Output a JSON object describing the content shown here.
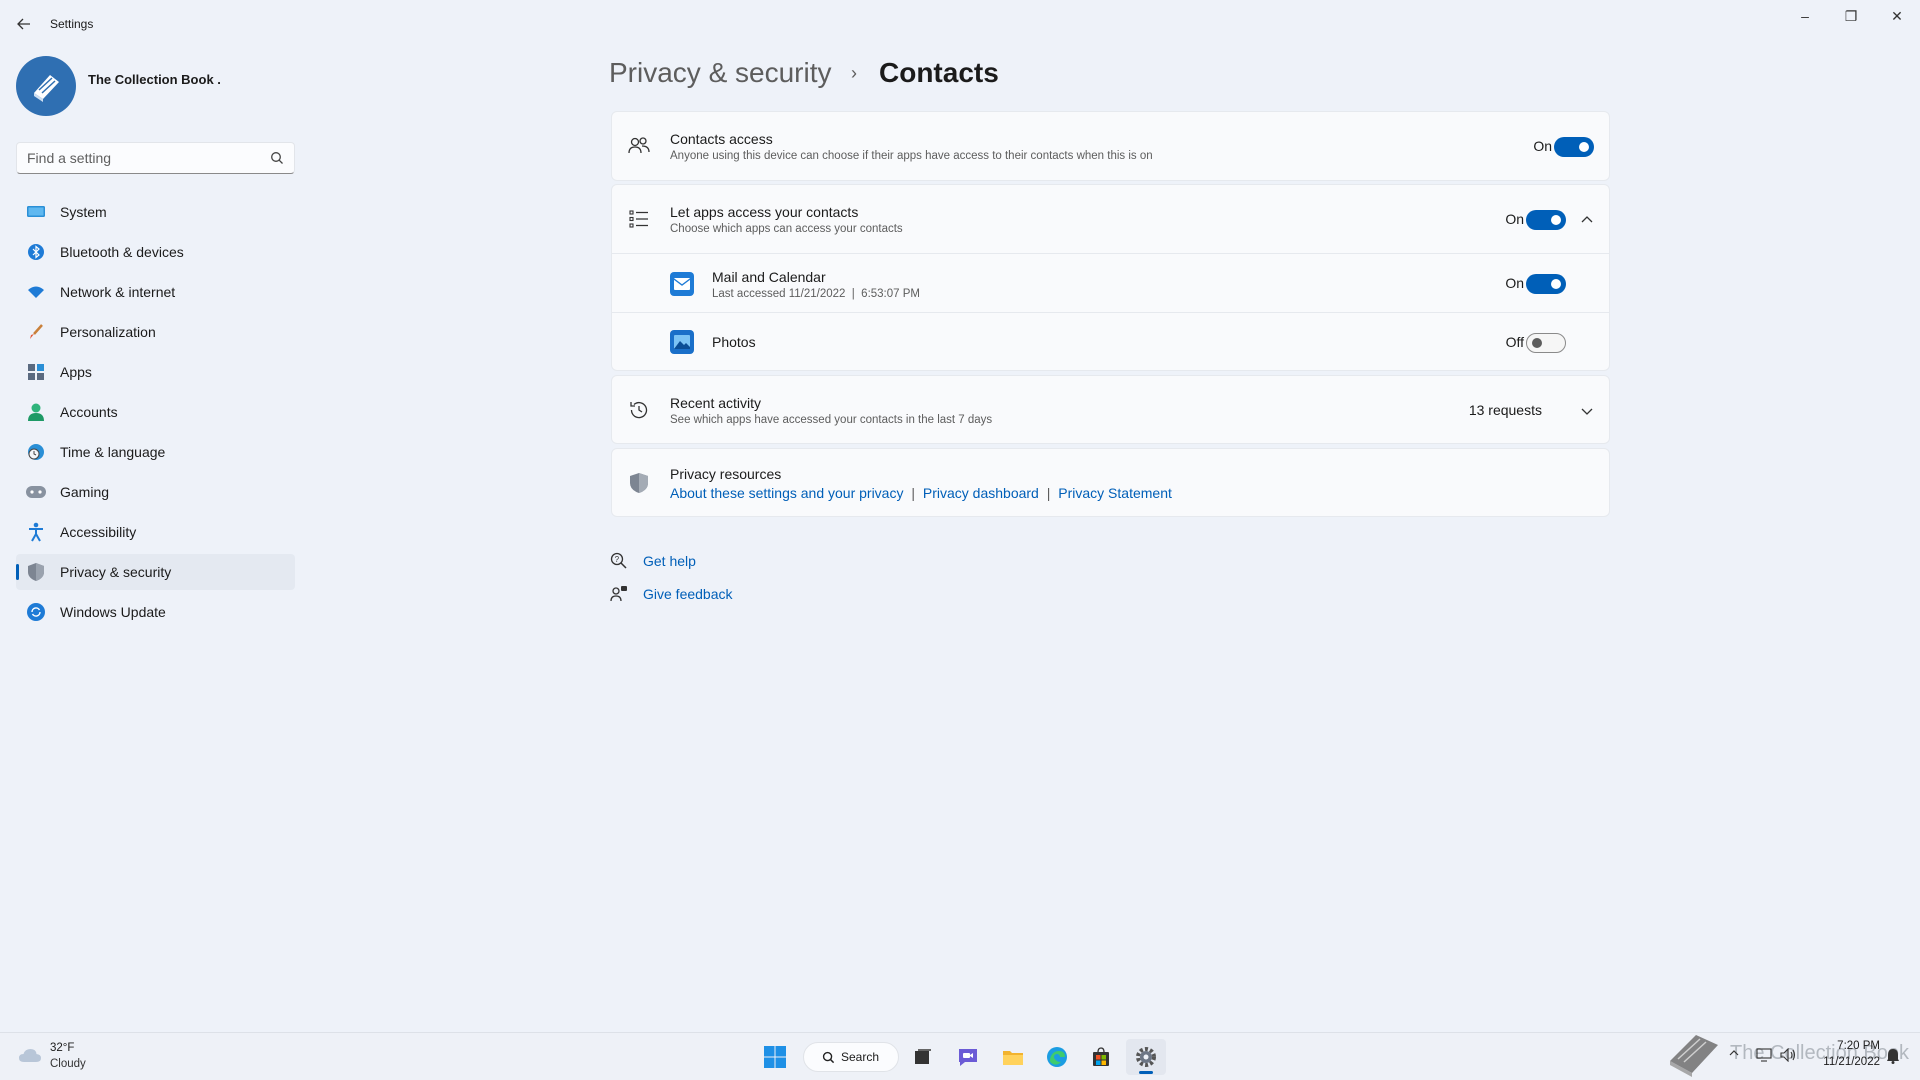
{
  "window": {
    "title": "Settings",
    "controls": {
      "minimize": "–",
      "maximize": "❐",
      "close": "✕"
    }
  },
  "profile": {
    "name": "The Collection Book ."
  },
  "search": {
    "placeholder": "Find a setting"
  },
  "nav": {
    "items": [
      {
        "label": "System",
        "icon": "system-icon"
      },
      {
        "label": "Bluetooth & devices",
        "icon": "bluetooth-icon"
      },
      {
        "label": "Network & internet",
        "icon": "wifi-icon"
      },
      {
        "label": "Personalization",
        "icon": "brush-icon"
      },
      {
        "label": "Apps",
        "icon": "apps-icon"
      },
      {
        "label": "Accounts",
        "icon": "person-icon"
      },
      {
        "label": "Time & language",
        "icon": "globe-clock-icon"
      },
      {
        "label": "Gaming",
        "icon": "gamepad-icon"
      },
      {
        "label": "Accessibility",
        "icon": "accessibility-icon"
      },
      {
        "label": "Privacy & security",
        "icon": "shield-icon",
        "active": true
      },
      {
        "label": "Windows Update",
        "icon": "update-icon"
      }
    ]
  },
  "header": {
    "parent": "Privacy & security",
    "separator": "›",
    "current": "Contacts"
  },
  "contacts_access": {
    "title": "Contacts access",
    "subtitle": "Anyone using this device can choose if their apps have access to their contacts when this is on",
    "state": "On",
    "enabled": true
  },
  "apps_access": {
    "title": "Let apps access your contacts",
    "subtitle": "Choose which apps can access your contacts",
    "state": "On",
    "enabled": true,
    "expanded": true,
    "apps": [
      {
        "name": "Mail and Calendar",
        "detail": "Last accessed 11/21/2022  |  6:53:07 PM",
        "state": "On",
        "enabled": true,
        "icon": "mail-icon"
      },
      {
        "name": "Photos",
        "detail": "",
        "state": "Off",
        "enabled": false,
        "icon": "photos-icon"
      }
    ]
  },
  "recent_activity": {
    "title": "Recent activity",
    "subtitle": "See which apps have accessed your contacts in the last 7 days",
    "count": "13 requests"
  },
  "privacy_resources": {
    "title": "Privacy resources",
    "links": [
      "About these settings and your privacy",
      "Privacy dashboard",
      "Privacy Statement"
    ],
    "separator": "|"
  },
  "help": {
    "get_help": "Get help",
    "give_feedback": "Give feedback"
  },
  "taskbar": {
    "weather_temp": "32°F",
    "weather_condition": "Cloudy",
    "search_label": "Search",
    "watermark": "The Collection Book",
    "time": "7:20 PM",
    "date": "11/21/2022"
  },
  "colors": {
    "accent": "#005fb8",
    "background": "#eef2f9",
    "card": "#f9fafc"
  }
}
